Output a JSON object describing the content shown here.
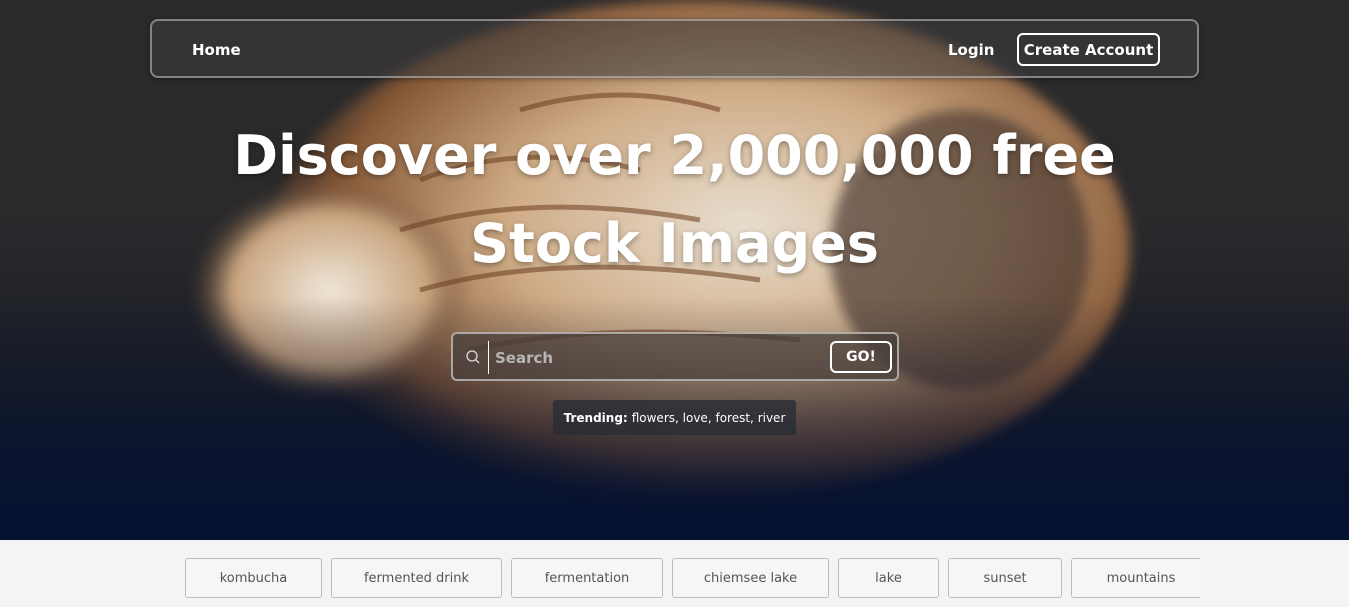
{
  "nav": {
    "home_label": "Home",
    "login_label": "Login",
    "create_account_label": "Create Account"
  },
  "hero": {
    "headline_line1": "Discover over 2,000,000 free",
    "headline_line2": "Stock Images"
  },
  "search": {
    "placeholder": "Search",
    "value": "",
    "go_label": "GO!",
    "icon": "search-icon"
  },
  "trending": {
    "label": "Trending:",
    "items": [
      "flowers",
      "love",
      "forest",
      "river"
    ]
  },
  "tags": [
    "kombucha",
    "fermented drink",
    "fermentation",
    "chiemsee lake",
    "lake",
    "sunset",
    "mountains"
  ],
  "colors": {
    "hero_bottom": "#061231",
    "tag_border": "#bdbdbd",
    "page_bg": "#f4f4f4"
  }
}
